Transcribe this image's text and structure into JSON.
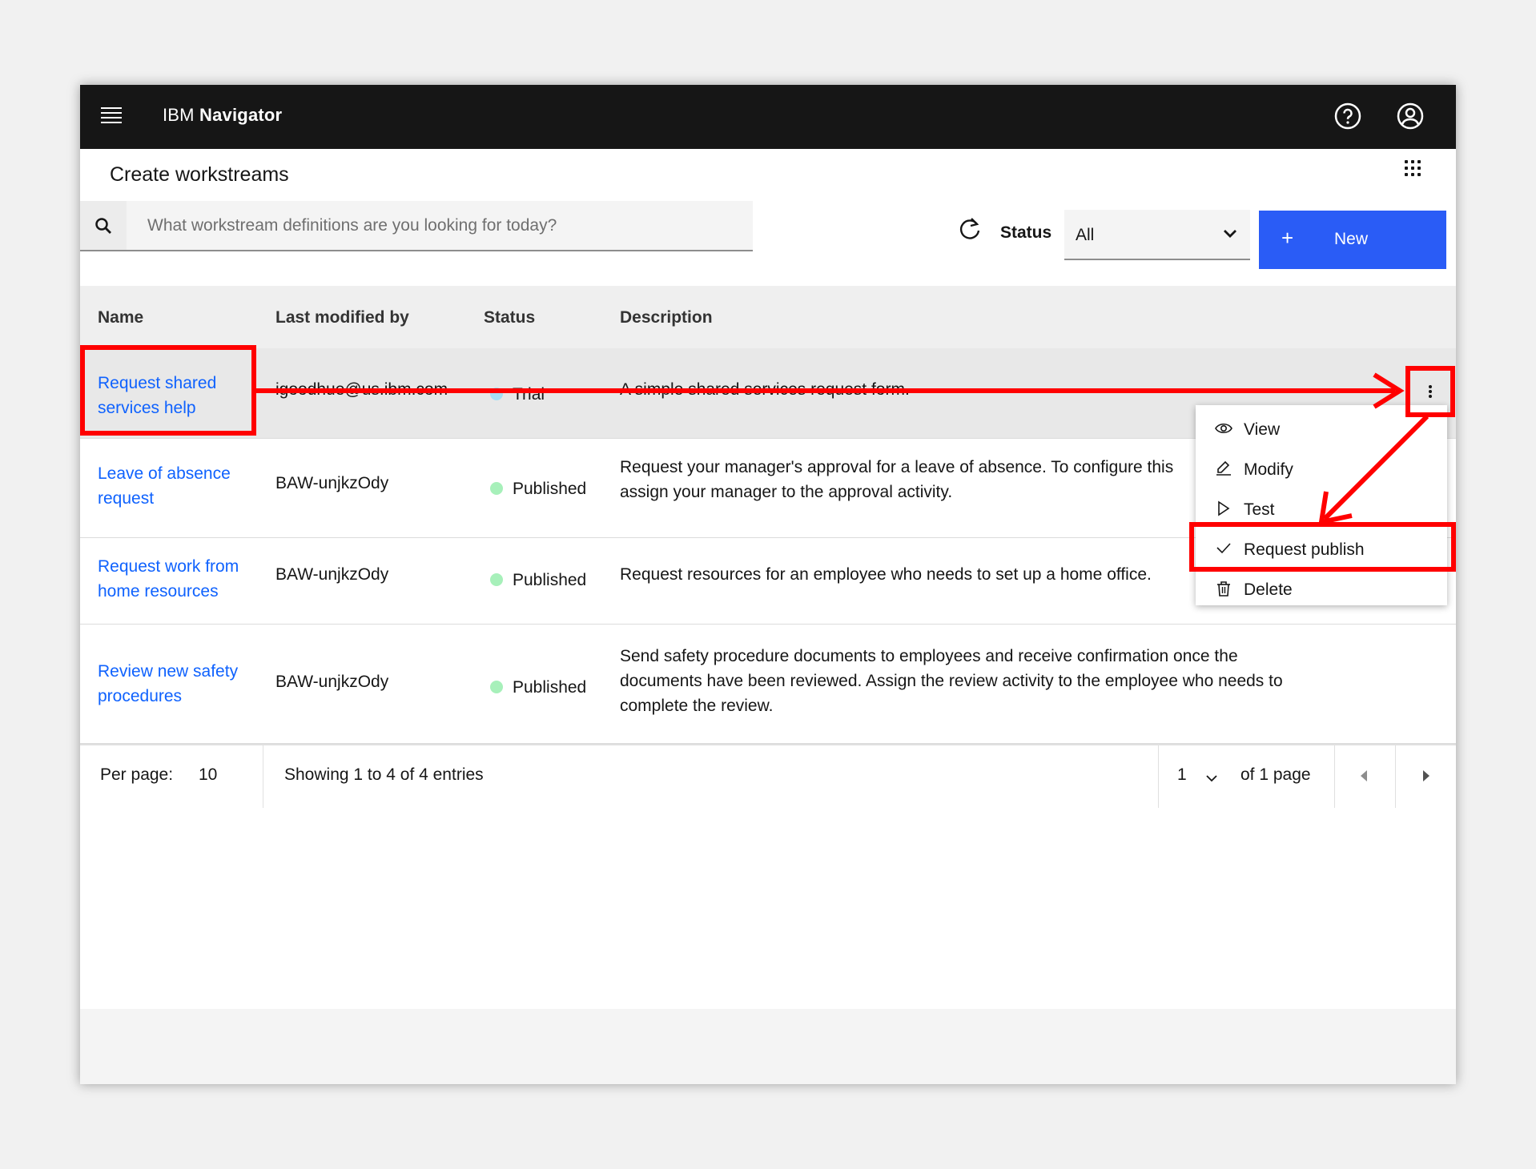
{
  "header": {
    "brand": "IBM",
    "product": "Navigator",
    "menu_icon": "hamburger-menu-icon",
    "help_icon": "help-icon",
    "user_icon": "user-avatar-icon"
  },
  "page": {
    "title": "Create workstreams",
    "apps_icon": "app-switcher-icon"
  },
  "toolbar": {
    "search_placeholder": "What workstream definitions are you looking for today?",
    "search_value": "",
    "refresh_icon": "refresh-icon",
    "status_label": "Status",
    "status_value": "All",
    "new_button_plus": "+",
    "new_button_label": "New"
  },
  "table": {
    "columns": [
      "Name",
      "Last modified by",
      "Status",
      "Description"
    ],
    "rows": [
      {
        "name_line1": "Request shared",
        "name_line2": "services help",
        "modified_by": "igoodhue@us.ibm.com",
        "status": "Trial",
        "description": "A simple shared services request form."
      },
      {
        "name_line1": "Leave of absence",
        "name_line2": "request",
        "modified_by": "BAW-unjkzOdy",
        "status": "Published",
        "description_line1": "Request your manager's approval for a leave of absence. To configure this",
        "description_line2": "assign your manager to the approval activity."
      },
      {
        "name_line1": "Request work from",
        "name_line2": "home resources",
        "modified_by": "BAW-unjkzOdy",
        "status": "Published",
        "description": "Request resources for an employee who needs to set up a home office."
      },
      {
        "name_line1": "Review new safety",
        "name_line2": "procedures",
        "modified_by": "BAW-unjkzOdy",
        "status": "Published",
        "description_line1": "Send safety procedure documents to employees and receive confirmation once the",
        "description_line2": "documents have been reviewed. Assign the review activity to the employee who needs to",
        "description_line3": "complete the review."
      }
    ],
    "status_dot_color": "#a7f0ba",
    "link_color": "#0f62fe"
  },
  "overflow_menu": {
    "items": [
      {
        "label": "View",
        "icon": "eye-icon"
      },
      {
        "label": "Modify",
        "icon": "pencil-icon"
      },
      {
        "label": "Test",
        "icon": "play-icon"
      },
      {
        "label": "Request publish",
        "icon": "checkmark-icon"
      },
      {
        "label": "Delete",
        "icon": "trash-icon"
      }
    ]
  },
  "pagination": {
    "per_page_label": "Per page:",
    "per_page_value": "10",
    "showing": "Showing 1 to 4 of 4 entries",
    "page_value": "1",
    "of_pages": "of 1 page"
  },
  "colors": {
    "topbar": "#161616",
    "primary": "#2a5cf6",
    "annotation": "#ff0000"
  }
}
